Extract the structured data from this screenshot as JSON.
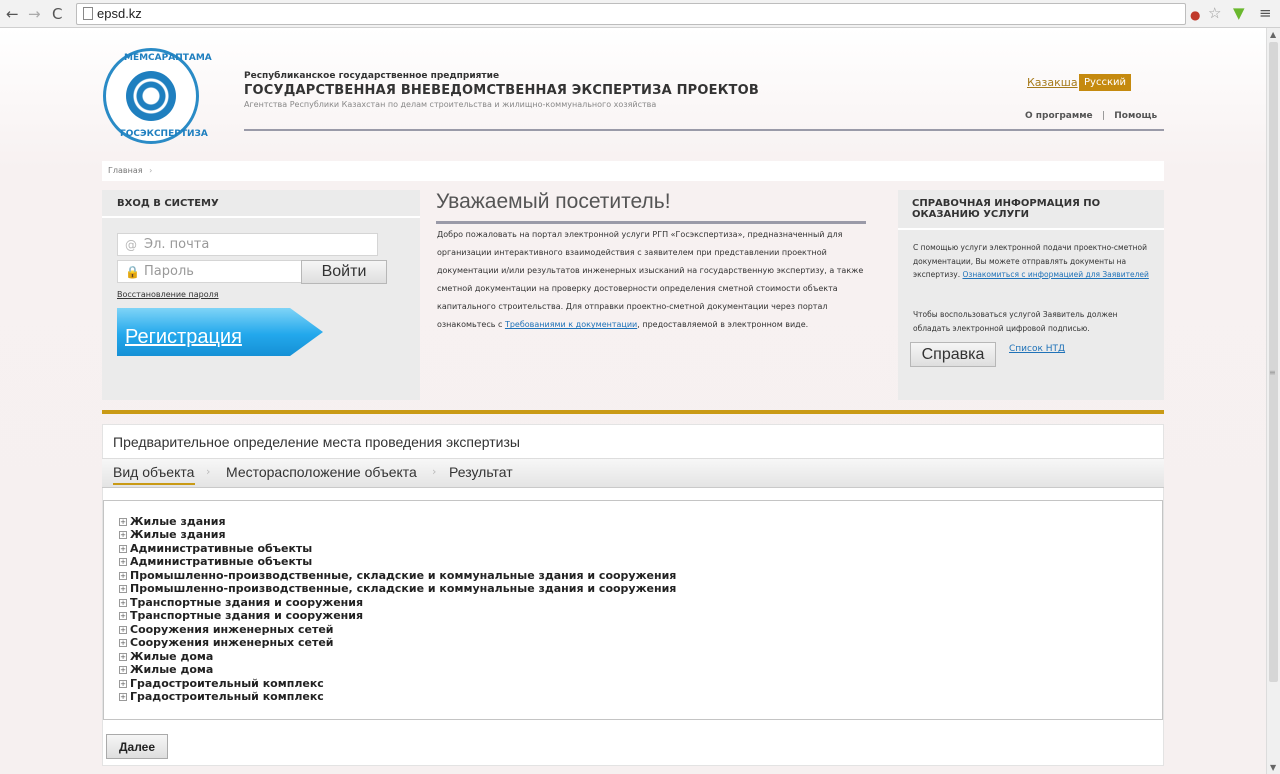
{
  "browser": {
    "url": "epsd.kz"
  },
  "header": {
    "org_small": "Республиканское государственное предприятие",
    "org_big": "ГОСУДАРСТВЕННАЯ ВНЕВЕДОМСТВЕННАЯ ЭКСПЕРТИЗА ПРОЕКТОВ",
    "org_sub": "Агентства Республики Казахстан по делам строительства и жилищно-коммунального хозяйства",
    "logo_top": "МЕМСАРАПТАМА",
    "logo_bottom": "ГОСЭКСПЕРТИЗА",
    "lang_kz": "Казакша",
    "lang_ru": "Русский",
    "link_about": "О программе",
    "link_sep": "|",
    "link_help": "Помощь"
  },
  "breadcrumb": {
    "home": "Главная",
    "sep": "›"
  },
  "login": {
    "title": "ВХОД В СИСТЕМУ",
    "email_placeholder": "Эл. почта",
    "password_placeholder": "Пароль",
    "login_button": "Войти",
    "recover": "Восстановление пароля",
    "register": "Регистрация"
  },
  "welcome": {
    "title": "Уважаемый посетитель!",
    "text_before_link": "Добро пожаловать на портал электронной услуги РГП «Госэкспертиза», предназначенный для организации интерактивного взаимодействия с заявителем при представлении проектной документации и/или результатов инженерных изысканий на государственную экспертизу, а также сметной документации на проверку достоверности определения сметной стоимости объекта капитального строительства. Для отправки проектно-сметной документации через портал ознакомьтесь с ",
    "link": "Требованиями к документации",
    "text_after_link": ", предоставляемой в электронном виде."
  },
  "info": {
    "title": "СПРАВОЧНАЯ ИНФОРМАЦИЯ ПО ОКАЗАНИЮ УСЛУГИ",
    "p1_text": "С помощью услуги электронной подачи проектно-сметной документации, Вы можете отправлять документы на экспертизу. ",
    "p1_link": "Ознакомиться с информацией для Заявителей",
    "p2_text": "Чтобы воспользоваться услугой Заявитель должен обладать электронной цифровой подписью.",
    "help_button": "Справка",
    "ntd_link": "Список НТД"
  },
  "prelim": {
    "title": "Предварительное определение места проведения экспертизы",
    "steps": [
      "Вид объекта",
      "Месторасположение объекта",
      "Результат"
    ],
    "step_sep": "›",
    "tree_expander": "+",
    "tree": [
      "Жилые здания",
      "Жилые здания",
      "Административные объекты",
      "Административные объекты",
      "Промышленно-производственные, складские и коммунальные здания и сооружения",
      "Промышленно-производственные, складские и коммунальные здания и сооружения",
      "Транспортные здания и сооружения",
      "Транспортные здания и сооружения",
      "Сооружения инженерных сетей",
      "Сооружения инженерных сетей",
      "Жилые дома",
      "Жилые дома",
      "Градостроительный комплекс",
      "Градостроительный комплекс"
    ],
    "next_button": "Далее"
  },
  "icons": {
    "back": "back-arrow-icon",
    "forward": "forward-arrow-icon",
    "reload": "reload-icon",
    "page": "page-icon",
    "adblock": "adblock-icon",
    "star": "star-icon",
    "download": "download-icon",
    "menu": "menu-icon",
    "email": "at-icon",
    "password": "lock-icon"
  },
  "colors": {
    "accent_gold": "#c99a15",
    "link_blue": "#1f72b8",
    "register_blue": "#23a8ec",
    "panel_gray": "#ebebeb"
  }
}
